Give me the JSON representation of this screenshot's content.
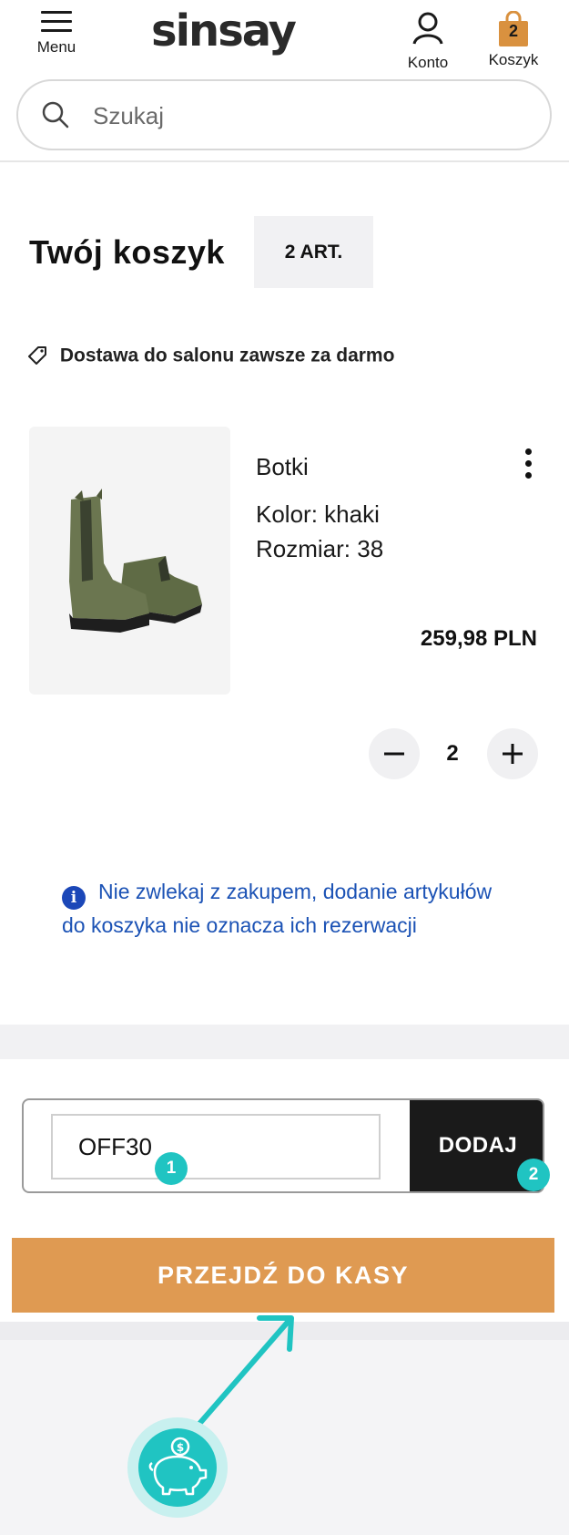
{
  "header": {
    "menu_label": "Menu",
    "logo": "sinsay",
    "account_label": "Konto",
    "cart_label": "Koszyk",
    "cart_count": "2",
    "cart_color": "#d9913f"
  },
  "search": {
    "placeholder": "Szukaj"
  },
  "cart": {
    "title": "Twój koszyk",
    "items_badge": "2 ART.",
    "delivery_note": "Dostawa do salonu zawsze za darmo"
  },
  "product": {
    "name": "Botki",
    "color": "Kolor: khaki",
    "size": "Rozmiar: 38",
    "price": "259,98 PLN",
    "quantity": "2",
    "image_icon": "khaki-chelsea-boots-image"
  },
  "info": {
    "text": "Nie zwlekaj z zakupem, dodanie artykułów do koszyka nie oznacza ich rezerwacji"
  },
  "promo": {
    "code_value": "OFF30",
    "add_label": "DODAJ"
  },
  "checkout": {
    "label": "PRZEJDŹ DO KASY",
    "color": "#df9a52"
  },
  "annotations": {
    "marker_1": "1",
    "marker_2": "2",
    "accent": "#20c4c2",
    "piggy_icon": "piggy-bank-icon"
  }
}
